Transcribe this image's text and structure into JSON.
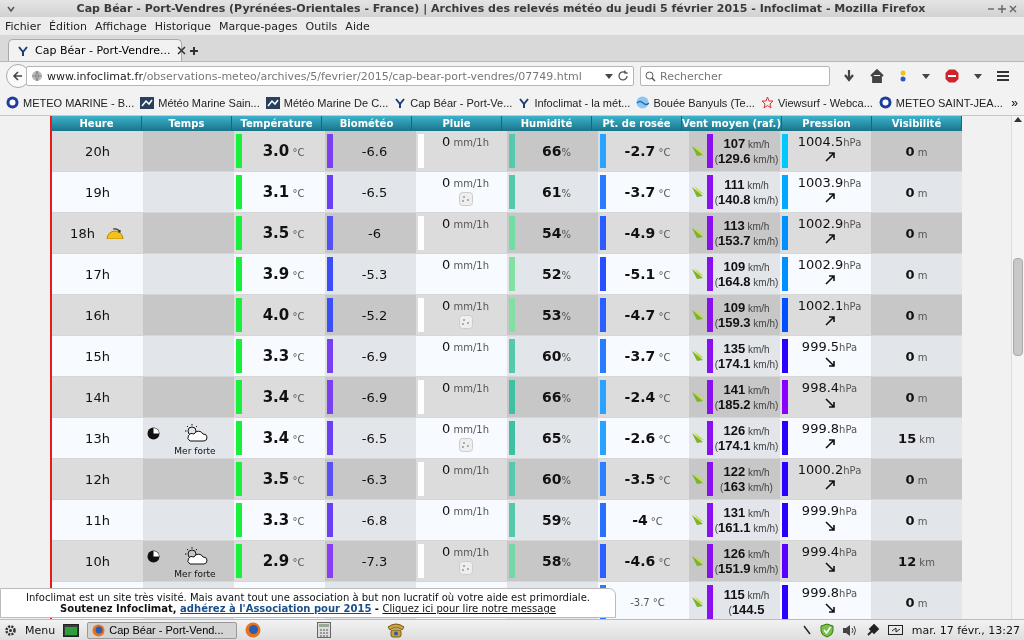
{
  "window": {
    "title": "Cap Béar - Port-Vendres (Pyrénées-Orientales - France) | Archives des relevés météo du jeudi 5 février 2015 - Infoclimat - Mozilla Firefox"
  },
  "menu": [
    "Fichier",
    "Édition",
    "Affichage",
    "Historique",
    "Marque-pages",
    "Outils",
    "Aide"
  ],
  "tabs": [
    {
      "label": "Cap Béar - Port-Vendre...",
      "selected": true
    }
  ],
  "address": {
    "host": "www.infoclimat.fr",
    "path": "/observations-meteo/archives/5/fevrier/2015/cap-bear-port-vendres/07749.html"
  },
  "search": {
    "placeholder": "Rechercher"
  },
  "bookmarks": [
    {
      "label": "METEO MARINE - B...",
      "kind": "disc"
    },
    {
      "label": "Météo Marine Sain...",
      "kind": "square"
    },
    {
      "label": "Météo Marine De C...",
      "kind": "square"
    },
    {
      "label": "Cap Béar - Port-Ve...",
      "kind": "fork"
    },
    {
      "label": "Infoclimat - la mét...",
      "kind": "fork"
    },
    {
      "label": "Bouée Banyuls (Te...",
      "kind": "wave"
    },
    {
      "label": "Viewsurf - Webca...",
      "kind": "star"
    },
    {
      "label": "METEO SAINT-JEA...",
      "kind": "disc"
    }
  ],
  "bookmarks_more": "»",
  "table": {
    "columns": [
      "Heure",
      "Temps",
      "Température",
      "Biométéo",
      "Pluie",
      "Humidité",
      "Pt. de rosée",
      "Vent moyen (raf.)",
      "Pression",
      "Visibilité"
    ],
    "rows": [
      {
        "hour": "20h",
        "sunset": false,
        "temp": "**3.0** °C",
        "bio": {
          "value": "-6.6",
          "color": "#7b3ff2"
        },
        "rain": "**0** mm/1h",
        "rain_sign": false,
        "hum": {
          "value": "**66**%",
          "color": "#55c8ae"
        },
        "dew": {
          "value": "**-2.7** °C",
          "color": "#2aa2ff"
        },
        "wind": "**107** km/h",
        "gust": "(**129.6** km/h)",
        "pressure": {
          "value": "1004.5",
          "unit": "hPa",
          "color": "#00c8ff",
          "kind": "rising"
        },
        "vis": "**0** m"
      },
      {
        "hour": "19h",
        "sunset": false,
        "temp": "**3.1** °C",
        "bio": {
          "value": "-6.5",
          "color": "#6a40f4"
        },
        "rain": "**0** mm/1h",
        "rain_sign": true,
        "hum": {
          "value": "**61**%",
          "color": "#55c8ae"
        },
        "dew": {
          "value": "**-3.7** °C",
          "color": "#2a7cff"
        },
        "wind": "**111** km/h",
        "gust": "(**140.8** km/h)",
        "pressure": {
          "value": "1003.9",
          "unit": "hPa",
          "color": "#00a8ff",
          "kind": "rising"
        },
        "vis": "**0** m"
      },
      {
        "hour": "18h",
        "sunset": true,
        "temp": "**3.5** °C",
        "bio": {
          "value": "-6",
          "color": "#5350f5"
        },
        "rain": "**0** mm/1h",
        "rain_sign": false,
        "hum": {
          "value": "**54**%",
          "color": "#72dca2"
        },
        "dew": {
          "value": "**-4.9** °C",
          "color": "#2a5cff"
        },
        "wind": "**113** km/h",
        "gust": "(**153.7** km/h)",
        "pressure": {
          "value": "1002.9",
          "unit": "hPa",
          "color": "#0090ff",
          "kind": "rising"
        },
        "vis": "**0** m"
      },
      {
        "hour": "17h",
        "sunset": false,
        "temp": "**3.9** °C",
        "bio": {
          "value": "-5.3",
          "color": "#3a4ff6"
        },
        "rain": "**0** mm/1h",
        "rain_sign": false,
        "hum": {
          "value": "**52**%",
          "color": "#82e0a2"
        },
        "dew": {
          "value": "**-5.1** °C",
          "color": "#2a50ff"
        },
        "wind": "**109** km/h",
        "gust": "(**164.8** km/h)",
        "pressure": {
          "value": "1002.9",
          "unit": "hPa",
          "color": "#0090ff",
          "kind": "rising"
        },
        "vis": "**0** m"
      },
      {
        "hour": "16h",
        "sunset": false,
        "temp": "**4.0** °C",
        "bio": {
          "value": "-5.2",
          "color": "#3a4ff6"
        },
        "rain": "**0** mm/1h",
        "rain_sign": true,
        "hum": {
          "value": "**53**%",
          "color": "#82e0a2"
        },
        "dew": {
          "value": "**-4.7** °C",
          "color": "#2a60ff"
        },
        "wind": "**109** km/h",
        "gust": "(**159.3** km/h)",
        "pressure": {
          "value": "1002.1",
          "unit": "hPa",
          "color": "#0050ff",
          "kind": "rising"
        },
        "vis": "**0** m"
      },
      {
        "hour": "15h",
        "sunset": false,
        "temp": "**3.3** °C",
        "bio": {
          "value": "-6.9",
          "color": "#7b3ff2"
        },
        "rain": "**0** mm/1h",
        "rain_sign": false,
        "hum": {
          "value": "**60**%",
          "color": "#55c8ae"
        },
        "dew": {
          "value": "**-3.7** °C",
          "color": "#2a7cff"
        },
        "wind": "**135** km/h",
        "gust": "(**174.1** km/h)",
        "pressure": {
          "value": "999.5",
          "unit": "hPa",
          "color": "#2a00ff",
          "kind": "falling"
        },
        "vis": "**0** m"
      },
      {
        "hour": "14h",
        "sunset": false,
        "temp": "**3.4** °C",
        "bio": {
          "value": "-6.9",
          "color": "#7b3ff2"
        },
        "rain": "**0** mm/1h",
        "rain_sign": false,
        "hum": {
          "value": "**66**%",
          "color": "#40c0a2"
        },
        "dew": {
          "value": "**-2.4** °C",
          "color": "#2aa2ff"
        },
        "wind": "**141** km/h",
        "gust": "(**185.2** km/h)",
        "pressure": {
          "value": "998.4",
          "unit": "hPa",
          "color": "#8a00ff",
          "kind": "falling"
        },
        "vis": "**0** m"
      },
      {
        "hour": "13h",
        "sunset": false,
        "weather": {
          "label": "Mer forte"
        },
        "temp": "**3.4** °C",
        "bio": {
          "value": "-6.5",
          "color": "#6a40f4"
        },
        "rain": "**0** mm/1h",
        "rain_sign": true,
        "hum": {
          "value": "**65**%",
          "color": "#40c0a2"
        },
        "dew": {
          "value": "**-2.6** °C",
          "color": "#2aa2ff"
        },
        "wind": "**126** km/h",
        "gust": "(**174.1** km/h)",
        "pressure": {
          "value": "999.8",
          "unit": "hPa",
          "color": "#2a00ff",
          "kind": "rising"
        },
        "vis": "**15** km"
      },
      {
        "hour": "12h",
        "sunset": false,
        "temp": "**3.5** °C",
        "bio": {
          "value": "-6.3",
          "color": "#5a50f5"
        },
        "rain": "**0** mm/1h",
        "rain_sign": false,
        "hum": {
          "value": "**60**%",
          "color": "#55c8ae"
        },
        "dew": {
          "value": "**-3.5** °C",
          "color": "#2a80ff"
        },
        "wind": "**122** km/h",
        "gust": "(**163** km/h)",
        "pressure": {
          "value": "1000.2",
          "unit": "hPa",
          "color": "#2a00ff",
          "kind": "rising"
        },
        "vis": "**0** m"
      },
      {
        "hour": "11h",
        "sunset": false,
        "temp": "**3.3** °C",
        "bio": {
          "value": "-6.8",
          "color": "#6a40f4"
        },
        "rain": "**0** mm/1h",
        "rain_sign": false,
        "hum": {
          "value": "**59**%",
          "color": "#55c8ae"
        },
        "dew": {
          "value": "**-4** °C",
          "color": "#2a70ff"
        },
        "wind": "**131** km/h",
        "gust": "(**161.1** km/h)",
        "pressure": {
          "value": "999.9",
          "unit": "hPa",
          "color": "#2a00ff",
          "kind": "falling"
        },
        "vis": "**0** m"
      },
      {
        "hour": "10h",
        "sunset": false,
        "weather": {
          "label": "Mer forte"
        },
        "temp": "**2.9** °C",
        "bio": {
          "value": "-7.3",
          "color": "#8a3df5"
        },
        "rain": "**0** mm/1h",
        "rain_sign": true,
        "hum": {
          "value": "**58**%",
          "color": "#72d8a8"
        },
        "dew": {
          "value": "**-4.6** °C",
          "color": "#2a60ff"
        },
        "wind": "**126** km/h",
        "gust": "(**151.9** km/h)",
        "pressure": {
          "value": "999.4",
          "unit": "hPa",
          "color": "#5a00ff",
          "kind": "falling"
        },
        "vis": "**12** km"
      },
      {
        "dew": {
          "value": "-3.7 °C",
          "color": "#2a7cff"
        },
        "wind": "**115** km/h",
        "gust": "(**144.5**",
        "pressure": {
          "value": "999.8",
          "unit": "hPa",
          "color": "#2a00ff",
          "kind": "falling"
        },
        "vis": "**0** m"
      }
    ]
  },
  "notice": {
    "text": "Infoclimat est un site très visité. Mais avant tout une association à but non lucratif où votre aide est primordiale.",
    "lead": "Soutenez Infoclimat,",
    "links": [
      "adhérez à l'Association pour 2015",
      "Cliquez ici pour lire notre message"
    ],
    "separator": "-"
  },
  "taskbar": {
    "menu": "Menu",
    "task": "Cap Béar - Port-Vend...",
    "clock": "mar. 17 févr., 13:27"
  }
}
